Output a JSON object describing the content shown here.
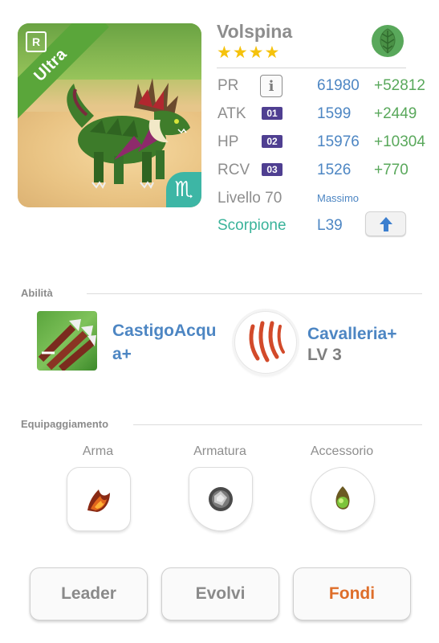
{
  "monster": {
    "name": "Volspina",
    "stars": "★★★★",
    "rarity": "Ultra",
    "rank_badge": "R",
    "zodiac_symbol": "♏",
    "element_icon": "leaf-icon"
  },
  "stats": {
    "pr": {
      "label": "PR",
      "value": "61980",
      "bonus": "+52812"
    },
    "atk": {
      "label": "ATK",
      "badge": "01",
      "value": "1599",
      "bonus": "+2449"
    },
    "hp": {
      "label": "HP",
      "badge": "02",
      "value": "15976",
      "bonus": "+10304"
    },
    "rcv": {
      "label": "RCV",
      "badge": "03",
      "value": "1526",
      "bonus": "+770"
    },
    "level": {
      "label": "Livello 70",
      "note": "Massimo"
    },
    "sign": {
      "label": "Scorpione",
      "value": "L39"
    },
    "info_glyph": "i"
  },
  "abilities": {
    "title": "Abilità",
    "skill1": {
      "name_line1": "CastigoAcqu",
      "name_line2": "a+",
      "icon": "arrows-icon"
    },
    "skill2": {
      "name": "Cavalleria+",
      "level": "LV 3",
      "icon": "claw-icon"
    }
  },
  "equipment": {
    "title": "Equipaggiamento",
    "slots": [
      {
        "label": "Arma",
        "icon": "fire-claw-icon"
      },
      {
        "label": "Armatura",
        "icon": "stone-orb-icon"
      },
      {
        "label": "Accessorio",
        "icon": "green-gem-icon"
      }
    ]
  },
  "buttons": {
    "leader": "Leader",
    "evolve": "Evolvi",
    "fuse": "Fondi"
  },
  "colors": {
    "blue_text": "#4d86c3",
    "green_bonus": "#59a85b",
    "teal": "#3ab39a",
    "ribbon_green": "#5aa63a",
    "badge_purple": "#4f3f91",
    "star_gold": "#f5c20c",
    "fondi_orange": "#de6e2a"
  }
}
